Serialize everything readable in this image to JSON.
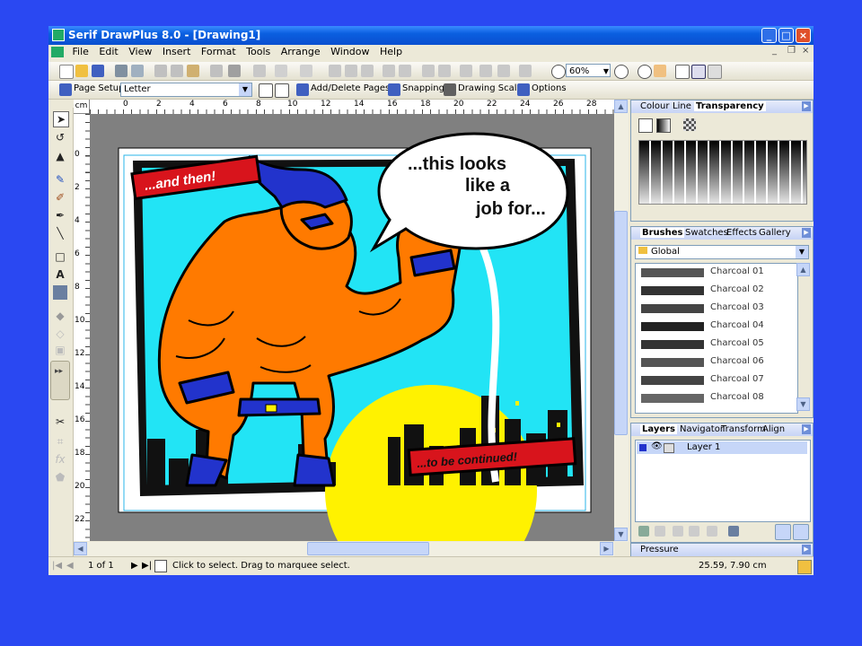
{
  "window": {
    "title": "Serif DrawPlus 8.0 - [Drawing1]",
    "controls": {
      "minimize": "_",
      "maximize": "□",
      "close": "×"
    }
  },
  "menu": {
    "items": [
      "File",
      "Edit",
      "View",
      "Insert",
      "Format",
      "Tools",
      "Arrange",
      "Window",
      "Help"
    ]
  },
  "toolbar": {
    "zoom": "60%"
  },
  "context_bar": {
    "page_setup": "Page Setup",
    "page_size": "Letter",
    "add_delete_pages": "Add/Delete Pages",
    "snapping": "Snapping",
    "drawing_scale": "Drawing Scale",
    "options": "Options"
  },
  "ruler": {
    "unit": "cm",
    "h_labels": [
      "0",
      "2",
      "4",
      "6",
      "8",
      "10",
      "12",
      "14",
      "16",
      "18",
      "20",
      "22",
      "24",
      "26",
      "28"
    ],
    "v_labels": [
      "0",
      "2",
      "4",
      "6",
      "8",
      "10",
      "12",
      "14",
      "16",
      "18",
      "20",
      "22"
    ]
  },
  "comic": {
    "caption_top": "...and then!",
    "speech_line1": "...this looks",
    "speech_line2": "like a",
    "speech_line3": "job for...",
    "caption_bottom": "...to be continued!"
  },
  "panel_transparency": {
    "tabs": [
      "Colour",
      "Line",
      "Transparency"
    ],
    "active": "Transparency"
  },
  "panel_brushes": {
    "tabs": [
      "Brushes",
      "Swatches",
      "Effects",
      "Gallery"
    ],
    "category": "Global",
    "items": [
      "Charcoal 01",
      "Charcoal 02",
      "Charcoal 03",
      "Charcoal 04",
      "Charcoal 05",
      "Charcoal 06",
      "Charcoal 07",
      "Charcoal 08"
    ]
  },
  "panel_layers": {
    "tabs": [
      "Layers",
      "Navigator",
      "Transform",
      "Align"
    ],
    "layers": [
      "Layer 1"
    ]
  },
  "panel_pressure": {
    "title": "Pressure"
  },
  "status": {
    "page": "1 of 1",
    "hint": "Click to select. Drag to marquee select.",
    "coords": "25.59, 7.90 cm"
  },
  "colors": {
    "desktop": "#2a48f2",
    "hero_skin": "#ff7a00",
    "sky": "#22e4f5",
    "caption_red": "#d8141c",
    "sun_yellow": "#fff200"
  }
}
